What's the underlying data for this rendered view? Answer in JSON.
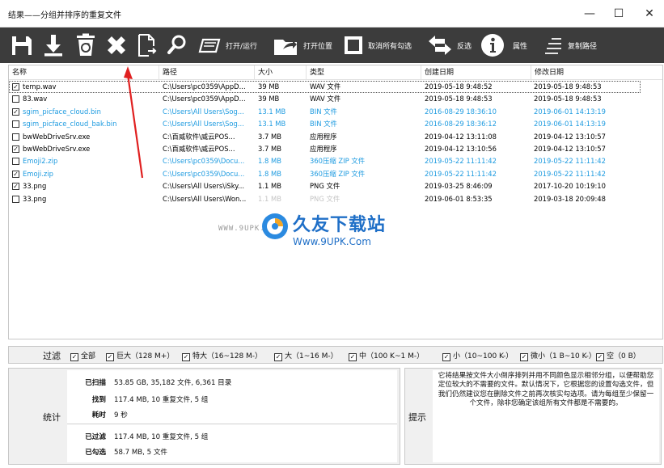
{
  "window": {
    "title": "结果——分组并排序的重复文件",
    "controls": {
      "minimize": "—",
      "maximize": "☐",
      "close": "✕"
    }
  },
  "toolbar": {
    "buttons": [
      {
        "name": "save",
        "icon": "save-icon",
        "label": ""
      },
      {
        "name": "download",
        "icon": "download-icon",
        "label": ""
      },
      {
        "name": "recycle",
        "icon": "recycle-bin-icon",
        "label": ""
      },
      {
        "name": "delete",
        "icon": "delete-x-icon",
        "label": ""
      },
      {
        "name": "export",
        "icon": "file-export-icon",
        "label": ""
      },
      {
        "name": "search",
        "icon": "search-icon",
        "label": ""
      },
      {
        "name": "open-run",
        "icon": "open-run-icon",
        "label": "打开/运行"
      },
      {
        "name": "open-location",
        "icon": "open-location-icon",
        "label": "打开位置"
      },
      {
        "name": "uncheck-all",
        "icon": "uncheck-all-icon",
        "label": "取消所有勾选"
      },
      {
        "name": "invert",
        "icon": "invert-arrows-icon",
        "label": "反选"
      },
      {
        "name": "properties",
        "icon": "info-icon",
        "label": "属性"
      },
      {
        "name": "copy-path",
        "icon": "copy-path-icon",
        "label": "复制路径"
      }
    ]
  },
  "list": {
    "columns": [
      "名称",
      "路径",
      "大小",
      "类型",
      "创建日期",
      "修改日期"
    ],
    "rows": [
      {
        "checked": true,
        "name": "temp.wav",
        "path": "C:\\Users\\pc0359\\AppD...",
        "size": "39 MB",
        "type": "WAV 文件",
        "created": "2019-05-18 9:48:52",
        "modified": "2019-05-18 9:48:53",
        "style": "normal",
        "selected": true
      },
      {
        "checked": false,
        "name": "83.wav",
        "path": "C:\\Users\\pc0359\\AppD...",
        "size": "39 MB",
        "type": "WAV 文件",
        "created": "2019-05-18 9:48:53",
        "modified": "2019-05-18 9:48:53",
        "style": "normal",
        "selected": false
      },
      {
        "checked": true,
        "name": "sgim_picface_cloud.bin",
        "path": "C:\\Users\\All Users\\Sog...",
        "size": "13.1 MB",
        "type": "BIN 文件",
        "created": "2016-08-29 18:36:10",
        "modified": "2019-06-01 14:13:19",
        "style": "blue",
        "selected": false
      },
      {
        "checked": false,
        "name": "sgim_picface_cloud_bak.bin",
        "path": "C:\\Users\\All Users\\Sog...",
        "size": "13.1 MB",
        "type": "BIN 文件",
        "created": "2016-08-29 18:36:12",
        "modified": "2019-06-01 14:13:19",
        "style": "blue",
        "selected": false
      },
      {
        "checked": false,
        "name": "bwWebDriveSrv.exe",
        "path": "C:\\百威软件\\威云POS...",
        "size": "3.7 MB",
        "type": "应用程序",
        "created": "2019-04-12 13:11:08",
        "modified": "2019-04-12 13:10:57",
        "style": "normal",
        "selected": false
      },
      {
        "checked": true,
        "name": "bwWebDriveSrv.exe",
        "path": "C:\\百威软件\\威云POS...",
        "size": "3.7 MB",
        "type": "应用程序",
        "created": "2019-04-12 13:10:56",
        "modified": "2019-04-12 13:10:57",
        "style": "normal",
        "selected": false
      },
      {
        "checked": false,
        "name": "Emoji2.zip",
        "path": "C:\\Users\\pc0359\\Docu...",
        "size": "1.8 MB",
        "type": "360压缩 ZIP 文件",
        "created": "2019-05-22 11:11:42",
        "modified": "2019-05-22 11:11:42",
        "style": "blue",
        "selected": false
      },
      {
        "checked": true,
        "name": "Emoji.zip",
        "path": "C:\\Users\\pc0359\\Docu...",
        "size": "1.8 MB",
        "type": "360压缩 ZIP 文件",
        "created": "2019-05-22 11:11:42",
        "modified": "2019-05-22 11:11:42",
        "style": "blue",
        "selected": false
      },
      {
        "checked": true,
        "name": "33.png",
        "path": "C:\\Users\\All Users\\iSky...",
        "size": "1.1 MB",
        "type": "PNG 文件",
        "created": "2019-03-25 8:46:09",
        "modified": "2017-10-20 10:19:10",
        "style": "normal",
        "selected": false
      },
      {
        "checked": false,
        "name": "33.png",
        "path": "C:\\Users\\All Users\\Won...",
        "size": "1.1 MB",
        "type": "PNG 文件",
        "created": "2019-06-01 8:53:35",
        "modified": "2019-03-18 20:09:48",
        "style": "grey",
        "selected": false
      }
    ]
  },
  "watermark": {
    "url_small": "WWW.9UPK.COM",
    "brand": "久友下载站",
    "url": "Www.9UPK.Com"
  },
  "filter": {
    "label": "过滤",
    "items": [
      {
        "checked": true,
        "label": "全部"
      },
      {
        "checked": true,
        "label": "巨大（128 M+）"
      },
      {
        "checked": true,
        "label": "特大（16~128 M-）"
      },
      {
        "checked": true,
        "label": "大（1~16 M-）"
      },
      {
        "checked": true,
        "label": "中（100 K~1 M-）"
      },
      {
        "checked": true,
        "label": "小（10~100 K-）"
      },
      {
        "checked": true,
        "label": "微小（1 B~10 K-）"
      },
      {
        "checked": true,
        "label": "空（0 B）"
      }
    ]
  },
  "stats": {
    "label": "统计",
    "rows": [
      {
        "key": "已扫描",
        "value": "53.85 GB, 35,182 文件, 6,361 目录"
      },
      {
        "key": "找到",
        "value": "117.4 MB, 10 重复文件, 5 组"
      },
      {
        "key": "耗时",
        "value": "9 秒"
      },
      {
        "key": "已过滤",
        "value": "117.4 MB, 10 重复文件, 5 组"
      },
      {
        "key": "已勾选",
        "value": "58.7 MB, 5 文件"
      }
    ]
  },
  "tip": {
    "label": "提示",
    "text": "它将结果按文件大小倒序排列并用不同颜色显示相邻分组，以便帮助您定位较大的不需要的文件。默认情况下，它根据您的设置勾选文件，但我们仍然建议您在删除文件之前再次核实勾选项。请为每组至少保留一个文件，除非您确定该组所有文件都是不需要的。"
  },
  "colors": {
    "toolbar_bg": "#3c3c3c",
    "blue_group": "#1e9be0",
    "annotation_arrow": "#e02020",
    "watermark_blue": "#1f6fc7"
  }
}
